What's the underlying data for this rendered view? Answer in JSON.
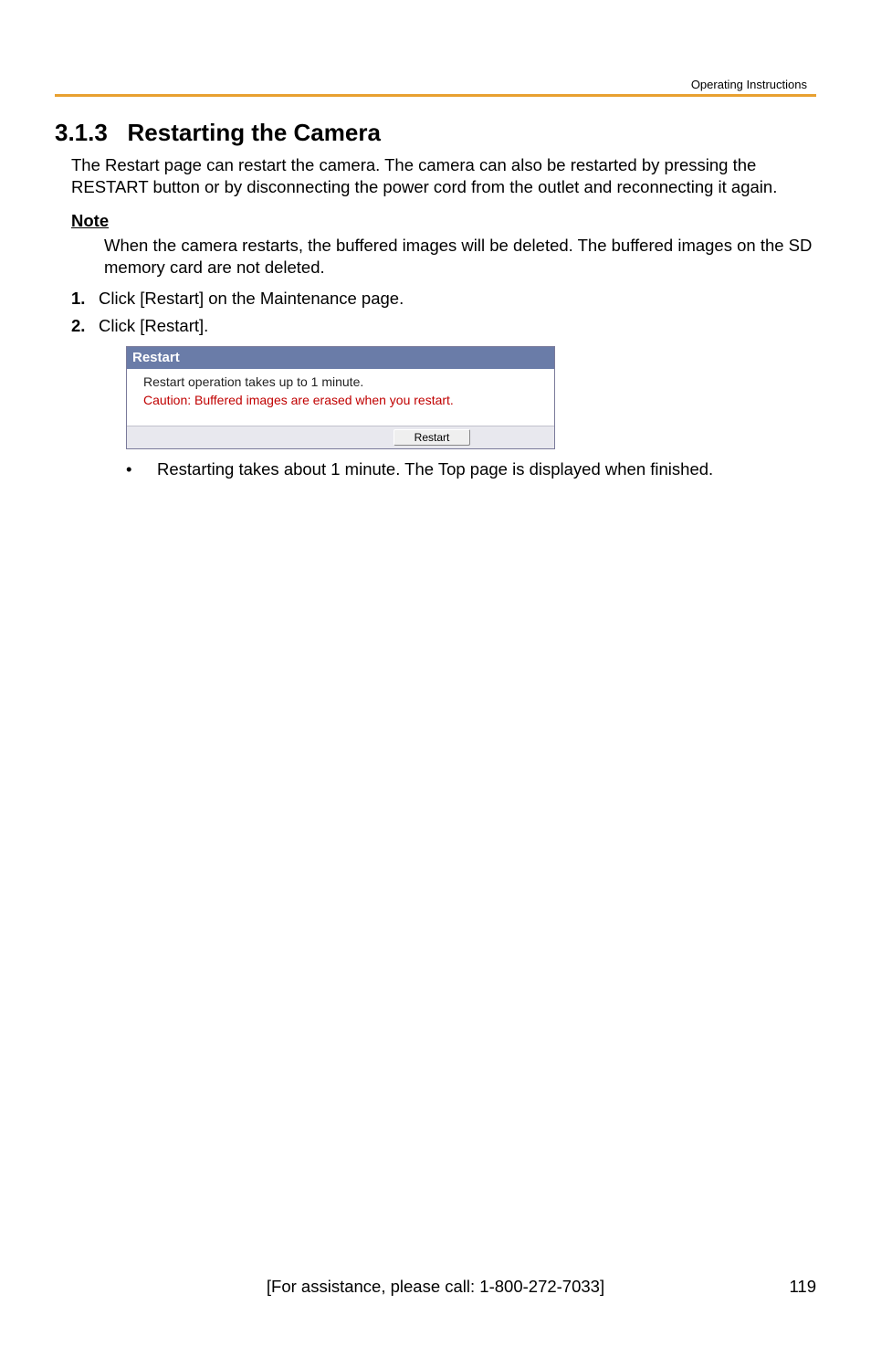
{
  "header": {
    "doc_label": "Operating Instructions"
  },
  "section": {
    "number": "3.1.3",
    "title": "Restarting the Camera"
  },
  "intro": "The Restart page can restart the camera. The camera can also be restarted by pressing the RESTART button or by disconnecting the power cord from the outlet and reconnecting it again.",
  "note": {
    "head": "Note",
    "body": "When the camera restarts, the buffered images will be deleted. The buffered images on the SD memory card are not deleted."
  },
  "steps": [
    {
      "num": "1.",
      "text": "Click [Restart] on the Maintenance page."
    },
    {
      "num": "2.",
      "text": "Click [Restart]."
    }
  ],
  "panel": {
    "title": "Restart",
    "line1": "Restart operation takes up to 1 minute.",
    "line2": "Caution: Buffered images are erased when you restart.",
    "button": "Restart"
  },
  "bullet": "Restarting takes about 1 minute. The Top page is displayed when finished.",
  "footer": {
    "assist": "[For assistance, please call: 1-800-272-7033]",
    "page": "119"
  }
}
